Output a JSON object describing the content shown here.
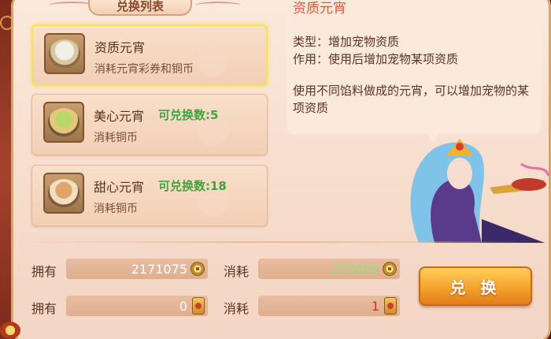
{
  "header": {
    "title": "兑换列表"
  },
  "items": [
    {
      "name": "资质元宵",
      "count": "",
      "desc": "消耗元宵彩券和铜币",
      "icon": "rice-ball-bowl-icon",
      "selected": true
    },
    {
      "name": "美心元宵",
      "count": "可兑换数:5",
      "desc": "消耗铜币",
      "icon": "green-rice-ball-bowl-icon",
      "selected": false
    },
    {
      "name": "甜心元宵",
      "count": "可兑换数:18",
      "desc": "消耗铜币",
      "icon": "brown-rice-ball-bowl-icon",
      "selected": false
    }
  ],
  "info": {
    "title": "资质元宵",
    "type_line": "类型：增加宠物资质",
    "effect_line": "作用：使用后增加宠物某项资质",
    "description": "使用不同馅料做成的元宵，可以增加宠物的某项资质"
  },
  "costs": {
    "row1": {
      "own_label": "拥有",
      "own_value": "2171075",
      "own_icon": "copper-coin-icon",
      "cost_label": "消耗",
      "cost_value": "250000",
      "cost_icon": "copper-coin-icon"
    },
    "row2": {
      "own_label": "拥有",
      "own_value": "0",
      "own_icon": "lantern-ticket-icon",
      "cost_label": "消耗",
      "cost_value": "1",
      "cost_icon": "lantern-ticket-icon"
    }
  },
  "actions": {
    "exchange_label": "兑 换"
  },
  "colors": {
    "accent": "#e25a3a",
    "count_green": "#3fa53f",
    "cost_green": "#8fe07c",
    "cost_red": "#e02b2b",
    "button": "#f3a22c"
  }
}
